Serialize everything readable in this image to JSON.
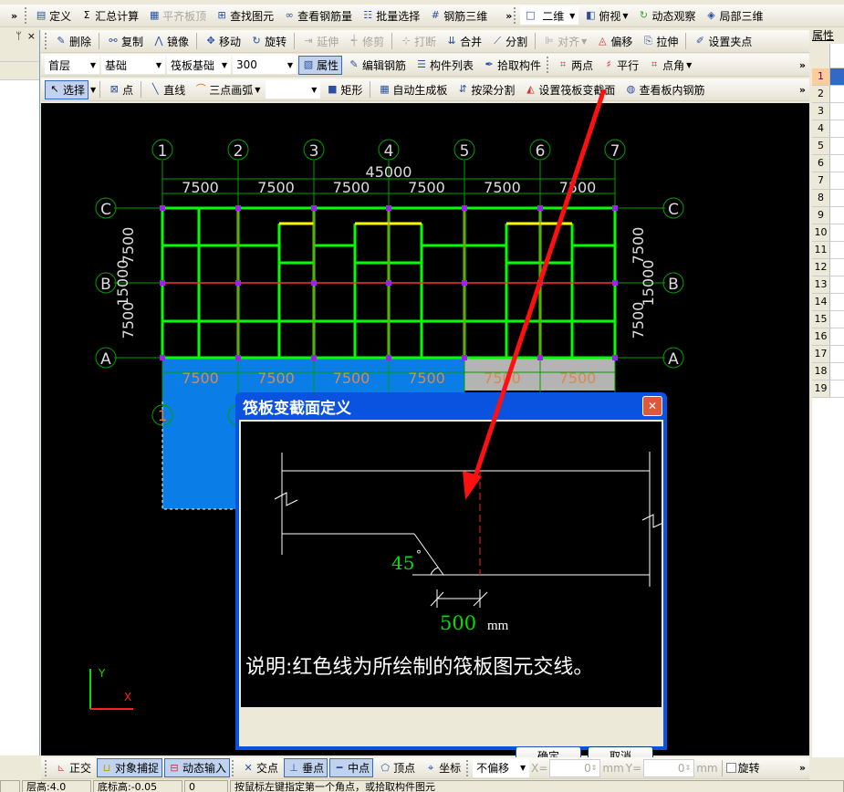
{
  "toolbar1": {
    "items": [
      "定义",
      "汇总计算",
      "平齐板顶",
      "查找图元",
      "查看钢筋量",
      "批量选择",
      "钢筋三维"
    ],
    "view_items": [
      "二维",
      "俯视",
      "动态观察",
      "局部三维"
    ]
  },
  "toolbar2": {
    "items": [
      "删除",
      "复制",
      "镜像",
      "移动",
      "旋转",
      "延伸",
      "修剪",
      "打断",
      "合并",
      "分割",
      "对齐",
      "偏移",
      "拉伸",
      "设置夹点"
    ]
  },
  "toolbar3": {
    "floor": "首层",
    "category": "基础",
    "type": "筏板基础",
    "name": "300",
    "items": [
      "属性",
      "编辑钢筋",
      "构件列表",
      "拾取构件"
    ],
    "axis_items": [
      "两点",
      "平行",
      "点角"
    ]
  },
  "toolbar4": {
    "items": [
      "选择",
      "点",
      "直线",
      "三点画弧",
      "",
      "矩形",
      "自动生成板",
      "按梁分割",
      "设置筏板变截面",
      "查看板内钢筋"
    ]
  },
  "left_panel": {
    "pin": "ᛘ",
    "close": "×"
  },
  "right_panel": {
    "title": "属性编",
    "rows": [
      "1",
      "2",
      "3",
      "4",
      "5",
      "6",
      "7",
      "8",
      "9",
      "10",
      "11",
      "12",
      "13",
      "14",
      "15",
      "16",
      "17",
      "18",
      "19"
    ]
  },
  "drawing": {
    "col_axes": [
      "1",
      "2",
      "3",
      "4",
      "5",
      "6",
      "7"
    ],
    "row_axes": [
      "C",
      "B",
      "A"
    ],
    "total_width": "45000",
    "spans": [
      "7500",
      "7500",
      "7500",
      "7500",
      "7500",
      "7500"
    ],
    "total_height": "15000",
    "row_spans": [
      "7500",
      "7500"
    ],
    "lower_spans": [
      "7500",
      "7500",
      "7500",
      "7500",
      "7500",
      "7500"
    ],
    "lower_axis": "1",
    "ucs_y": "Y",
    "ucs_x": "X"
  },
  "dialog": {
    "title": "筏板变截面定义",
    "angle": "45",
    "angle_unit": "°",
    "width_value": "500",
    "width_unit": "mm",
    "note": "说明:红色线为所绘制的筏板图元交线。",
    "ok": "确定",
    "cancel": "取消"
  },
  "bottom_bar": {
    "items": [
      "正交",
      "对象捕捉",
      "动态输入",
      "交点",
      "垂点",
      "中点",
      "顶点",
      "坐标"
    ],
    "offset": "不偏移",
    "x_label": "X=",
    "x_value": "0",
    "y_label": "Y=",
    "y_value": "0",
    "unit": "mm",
    "rotate": "旋转"
  },
  "status": {
    "floor_height": "层高:4.0",
    "base_elev": "底标高:-0.05",
    "value": "0",
    "hint": "按鼠标左键指定第一个角点，或拾取构件图元"
  },
  "colors": {
    "beam": "#00ff00",
    "axis": "#00a000",
    "slab_blue": "#0a7de6",
    "slab_gray": "#b4b4b4",
    "arrow": "#ff1010",
    "title_blue": "#0a53e0"
  }
}
